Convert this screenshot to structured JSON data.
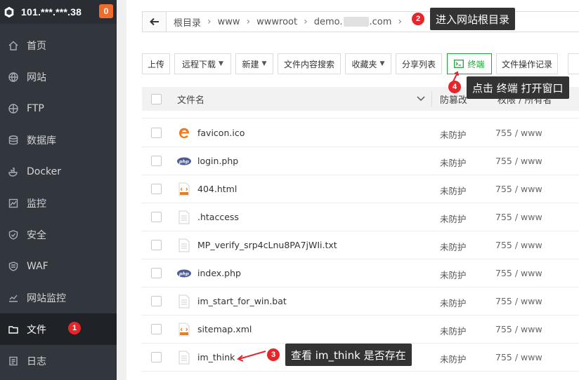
{
  "sidebar": {
    "ip": "101.***.***.38",
    "badge": "0",
    "items": [
      {
        "label": "首页",
        "icon": "home-icon"
      },
      {
        "label": "网站",
        "icon": "globe-icon"
      },
      {
        "label": "FTP",
        "icon": "ftp-globe-icon"
      },
      {
        "label": "数据库",
        "icon": "database-icon"
      },
      {
        "label": "Docker",
        "icon": "docker-icon"
      },
      {
        "label": "监控",
        "icon": "monitor-icon"
      },
      {
        "label": "安全",
        "icon": "shield-icon"
      },
      {
        "label": "WAF",
        "icon": "waf-shield-icon"
      },
      {
        "label": "网站监控",
        "icon": "chart-line-icon"
      },
      {
        "label": "文件",
        "icon": "folder-icon",
        "active": true
      },
      {
        "label": "日志",
        "icon": "log-icon"
      }
    ]
  },
  "address": {
    "crumbs": [
      "根目录",
      "www",
      "wwwroot"
    ],
    "domain_prefix": "demo.",
    "domain_suffix": ".com"
  },
  "toolbar": {
    "upload": "上传",
    "remote_download": "远程下载",
    "new": "新建",
    "content_search": "文件内容搜索",
    "favorites": "收藏夹",
    "share_list": "分享列表",
    "terminal": "终端",
    "file_log": "文件操作记录"
  },
  "table": {
    "col_name": "文件名",
    "col_protect": "防篡改",
    "col_perm": "权限 / 所有者",
    "rows": [
      {
        "name": "favicon.ico",
        "icon": "favicon-file-icon",
        "protect": "未防护",
        "perm": "755 / www"
      },
      {
        "name": "login.php",
        "icon": "php-file-icon",
        "protect": "未防护",
        "perm": "755 / www"
      },
      {
        "name": "404.html",
        "icon": "html-file-icon",
        "protect": "未防护",
        "perm": "755 / www"
      },
      {
        "name": ".htaccess",
        "icon": "text-file-icon",
        "protect": "未防护",
        "perm": "755 / www"
      },
      {
        "name": "MP_verify_srp4cLnu8PA7jWIi.txt",
        "icon": "text-file-icon",
        "protect": "未防护",
        "perm": "755 / www"
      },
      {
        "name": "index.php",
        "icon": "php-file-icon",
        "protect": "未防护",
        "perm": "755 / www"
      },
      {
        "name": "im_start_for_win.bat",
        "icon": "text-file-icon",
        "protect": "未防护",
        "perm": "755 / www"
      },
      {
        "name": "sitemap.xml",
        "icon": "xml-file-icon",
        "protect": "未防护",
        "perm": "755 / www"
      },
      {
        "name": "im_think",
        "icon": "text-file-icon",
        "protect": "未防护",
        "perm": "755 / www"
      }
    ]
  },
  "annotations": {
    "n1": "1",
    "n2": "2",
    "tip2": "进入网站根目录",
    "n3": "3",
    "tip3": "查看 im_think 是否存在",
    "n4": "4",
    "tip4": "点击 终端 打开窗口"
  },
  "colors": {
    "sidebar_bg": "#32373e",
    "accent_green": "#20a53a",
    "badge_orange": "#f06c2c",
    "annotation_red": "#e8242b"
  }
}
